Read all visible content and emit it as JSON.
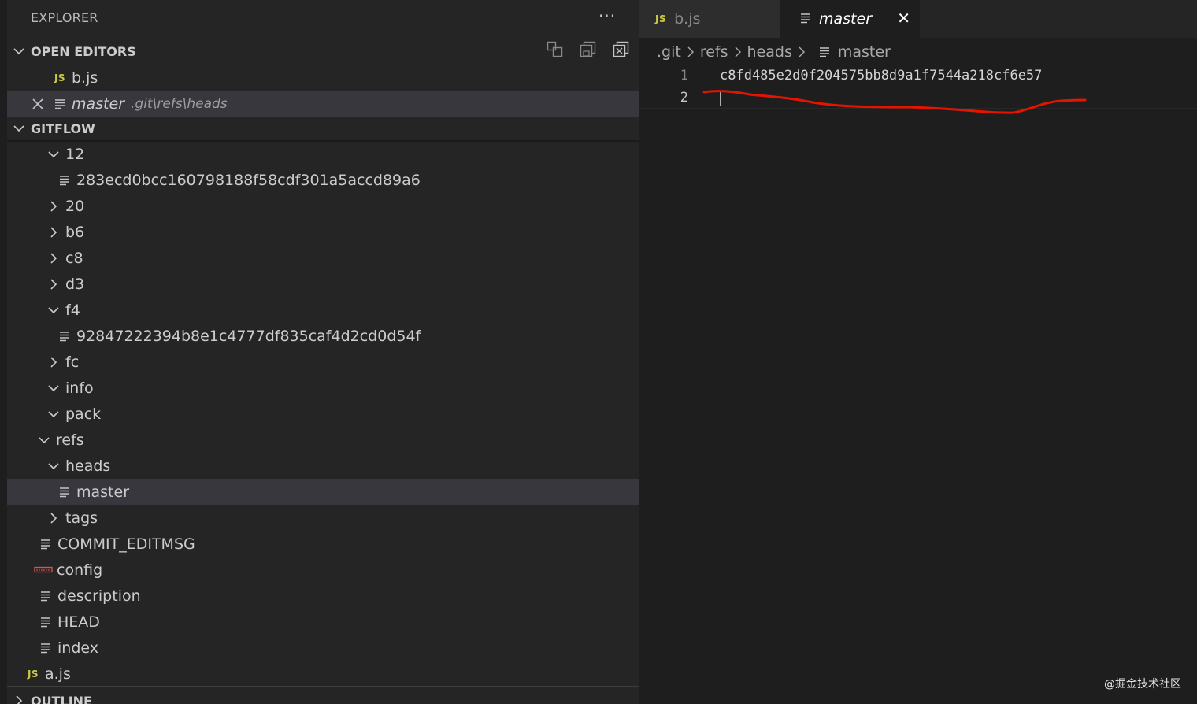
{
  "sidebar": {
    "title": "EXPLORER",
    "more": "···",
    "open_editors": {
      "header": "OPEN EDITORS",
      "items": [
        {
          "icon": "JS",
          "label": "b.js"
        },
        {
          "label": "master",
          "description": ".git\\refs\\heads"
        }
      ]
    },
    "gitflow": {
      "header": "GITFLOW",
      "items": [
        {
          "label": "12"
        },
        {
          "label": "283ecd0bcc160798188f58cdf301a5accd89a6"
        },
        {
          "label": "20"
        },
        {
          "label": "b6"
        },
        {
          "label": "c8"
        },
        {
          "label": "d3"
        },
        {
          "label": "f4"
        },
        {
          "label": "92847222394b8e1c4777df835caf4d2cd0d54f"
        },
        {
          "label": "fc"
        },
        {
          "label": "info"
        },
        {
          "label": "pack"
        },
        {
          "label": "refs"
        },
        {
          "label": "heads"
        },
        {
          "label": "master"
        },
        {
          "label": "tags"
        },
        {
          "label": "COMMIT_EDITMSG"
        },
        {
          "label": "config"
        },
        {
          "label": "description"
        },
        {
          "label": "HEAD"
        },
        {
          "label": "index"
        },
        {
          "label": "a.js",
          "icon": "JS"
        }
      ]
    },
    "outline": {
      "header": "OUTLINE"
    }
  },
  "editor": {
    "tabs": [
      {
        "icon": "JS",
        "label": "b.js"
      },
      {
        "label": "master",
        "close": "✕"
      }
    ],
    "breadcrumb": [
      ".git",
      "refs",
      "heads",
      "master"
    ],
    "lines": [
      {
        "number": "1",
        "text": "c8fd485e2d0f204575bb8d9a1f7544a218cf6e57"
      },
      {
        "number": "2",
        "text": ""
      }
    ]
  },
  "watermark": "@掘金技术社区",
  "colors": {
    "sidebar_bg": "#252526",
    "editor_bg": "#1e1e1e",
    "selection": "#37373d",
    "js_yellow": "#cbcb41",
    "annotation_red": "#e51400"
  }
}
